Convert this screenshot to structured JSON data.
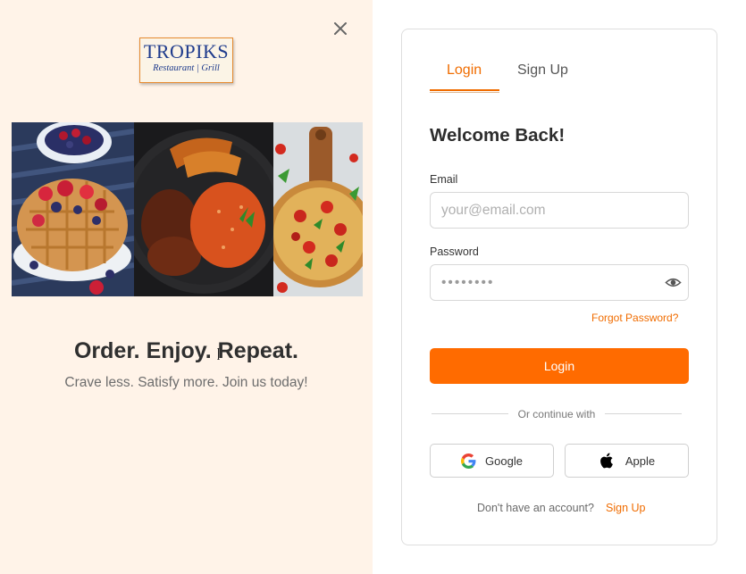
{
  "left": {
    "logo": {
      "top": "TROPIKS",
      "bottom": "Restaurant | Grill"
    },
    "tagline": "Order. Enjoy. Repeat.",
    "subtagline": "Crave less. Satisfy more. Join us today!",
    "photos": [
      "waffles",
      "jollof-rice-plantain-chicken",
      "pizza"
    ]
  },
  "card": {
    "tabs": [
      {
        "label": "Login",
        "active": true
      },
      {
        "label": "Sign Up",
        "active": false
      }
    ],
    "title": "Welcome Back!",
    "email": {
      "label": "Email",
      "placeholder": "your@email.com",
      "value": ""
    },
    "password": {
      "label": "Password",
      "masked_value": "••••••••"
    },
    "forgot_link": "Forgot Password?",
    "login_button": "Login",
    "divider": "Or continue with",
    "social": [
      {
        "label": "Google",
        "icon": "google-icon"
      },
      {
        "label": "Apple",
        "icon": "apple-icon"
      }
    ],
    "footer_text": "Don't have an account?",
    "footer_link": "Sign Up"
  },
  "colors": {
    "accent": "#ff6b00",
    "left_bg": "#fff3e8",
    "logo_blue": "#1e3b8c"
  }
}
